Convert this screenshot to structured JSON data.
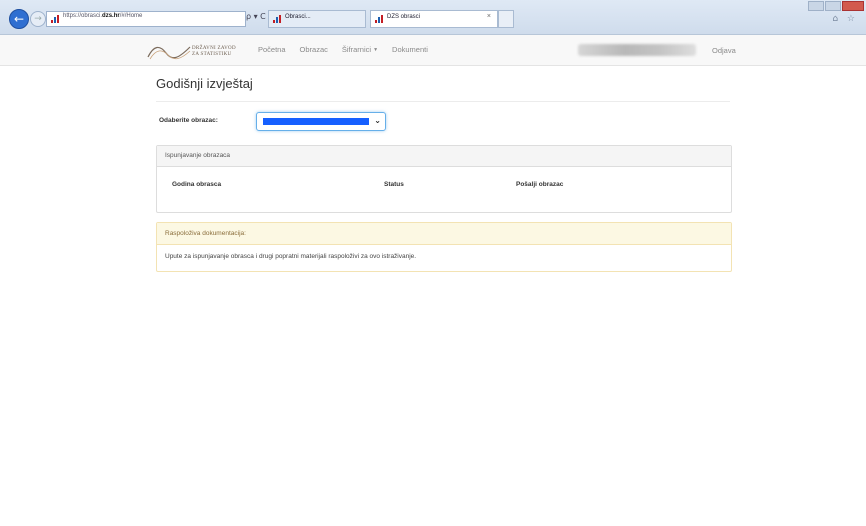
{
  "browser": {
    "url_prefix": "https://obrasci.",
    "url_domain": "dzs.hr",
    "url_suffix": "/#/Home",
    "address_tools": "ρ ▾ C",
    "tabs": [
      {
        "title": "Obrasci..."
      },
      {
        "title": "DZS obrasci",
        "close": "×"
      }
    ],
    "nav_back_glyph": "←",
    "nav_fwd_glyph": "→",
    "right_icons": "⌂ ☆"
  },
  "app": {
    "logo_line1": "DRŽAVNI ZAVOD",
    "logo_line2": "ZA STATISTIKU",
    "menu": [
      {
        "label": "Početna"
      },
      {
        "label": "Obrazac"
      },
      {
        "label": "Šifrarnici",
        "caret": "▼"
      },
      {
        "label": "Dokumenti"
      }
    ],
    "logout_label": "Odjava"
  },
  "page": {
    "title": "Godišnji izvještaj",
    "form_label": "Odaberite obrazac:",
    "select_caret": "⌄"
  },
  "forms_panel": {
    "heading": "Ispunjavanje obrazaca",
    "columns": [
      "Godina obrasca",
      "Status",
      "Pošalji obrazac"
    ]
  },
  "docs_panel": {
    "heading": "Raspoloživa dokumentacija:",
    "body": "Upute za ispunjavanje obrasca i drugi popratni materijali raspoloživi za ovo istraživanje."
  },
  "colors": {
    "selected_highlight": "#1660ff",
    "warning_panel_bg": "#fcf8e3",
    "warning_text": "#8a6d3b"
  }
}
